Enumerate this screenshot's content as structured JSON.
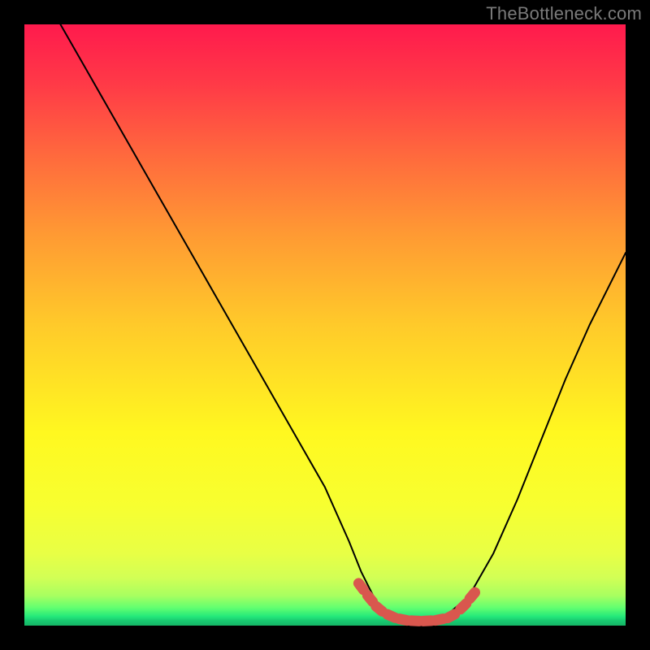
{
  "watermark": "TheBottleneck.com",
  "colors": {
    "background": "#000000",
    "gradient_top": "#ff1a4d",
    "gradient_mid": "#fff820",
    "gradient_bottom": "#15b566",
    "curve": "#000000",
    "marker": "#d9574e"
  },
  "chart_data": {
    "type": "line",
    "title": "",
    "xlabel": "",
    "ylabel": "",
    "xlim": [
      0,
      100
    ],
    "ylim": [
      0,
      100
    ],
    "series": [
      {
        "name": "bottleneck-curve",
        "x": [
          6,
          10,
          14,
          18,
          22,
          26,
          30,
          34,
          38,
          42,
          46,
          50,
          54,
          56,
          58,
          60,
          62,
          64,
          66,
          68,
          70,
          74,
          78,
          82,
          86,
          90,
          94,
          98,
          100
        ],
        "y": [
          100,
          93,
          86,
          79,
          72,
          65,
          58,
          51,
          44,
          37,
          30,
          23,
          14,
          9,
          5,
          2,
          0.8,
          0.4,
          0.4,
          0.6,
          1.5,
          5,
          12,
          21,
          31,
          41,
          50,
          58,
          62
        ]
      }
    ],
    "markers": {
      "name": "marker-band",
      "shape": "rounded-segment",
      "x": [
        56,
        57.5,
        59,
        61,
        63,
        65,
        67,
        69,
        71,
        73,
        74.5
      ],
      "y": [
        6.5,
        4.5,
        2.8,
        1.6,
        1.0,
        0.8,
        0.8,
        1.0,
        1.6,
        3.2,
        5.0
      ]
    }
  }
}
